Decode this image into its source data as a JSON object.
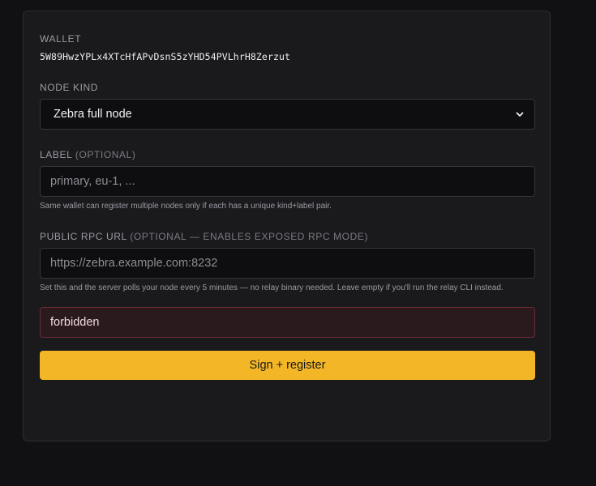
{
  "wallet": {
    "label": "WALLET",
    "address": "5W89HwzYPLx4XTcHfAPvDsnS5zYHD54PVLhrH8Zerzut"
  },
  "node_kind": {
    "label": "NODE KIND",
    "selected": "Zebra full node",
    "icon": "chevron-down-icon"
  },
  "label_field": {
    "label": "LABEL",
    "optional": "(OPTIONAL)",
    "placeholder": "primary, eu-1, ...",
    "value": "",
    "hint": "Same wallet can register multiple nodes only if each has a unique kind+label pair."
  },
  "rpc_field": {
    "label": "PUBLIC RPC URL",
    "optional": "(OPTIONAL — ENABLES EXPOSED RPC MODE)",
    "placeholder": "https://zebra.example.com:8232",
    "value": "",
    "hint": "Set this and the server polls your node every 5 minutes — no relay binary needed. Leave empty if you'll run the relay CLI instead."
  },
  "error": {
    "message": "forbidden"
  },
  "submit": {
    "label": "Sign + register"
  },
  "colors": {
    "accent": "#f3b626",
    "error_bg": "#2a1a1e",
    "error_border": "#6a2c34"
  }
}
